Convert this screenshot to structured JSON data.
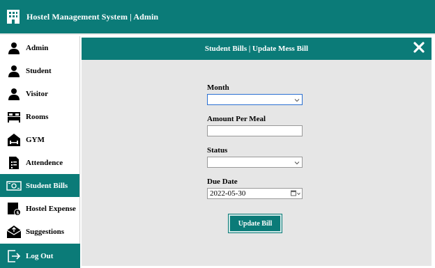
{
  "app": {
    "title": "Hostel Management System | Admin"
  },
  "sidebar": {
    "items": [
      {
        "label": "Admin",
        "icon": "user-icon"
      },
      {
        "label": "Student",
        "icon": "user-icon"
      },
      {
        "label": "Visitor",
        "icon": "user-icon"
      },
      {
        "label": "Rooms",
        "icon": "bed-icon"
      },
      {
        "label": "GYM",
        "icon": "dumbbell-icon"
      },
      {
        "label": "Attendence",
        "icon": "document-icon"
      },
      {
        "label": "Student Bills",
        "icon": "money-icon",
        "active": true
      },
      {
        "label": "Hostel Expense",
        "icon": "expense-icon"
      },
      {
        "label": "Suggestions",
        "icon": "mail-icon"
      }
    ],
    "logout_label": "Log Out"
  },
  "panel": {
    "title": "Student Bills | Update Mess Bill"
  },
  "form": {
    "month_label": "Month",
    "month_value": "",
    "amount_label": "Amount Per Meal",
    "amount_value": "",
    "status_label": "Status",
    "status_value": "",
    "due_label": "Due Date",
    "due_value": "2022-05-30",
    "submit_label": "Update Bill"
  },
  "colors": {
    "accent": "#0b7b78",
    "panel_bg": "#e6e6e6"
  }
}
